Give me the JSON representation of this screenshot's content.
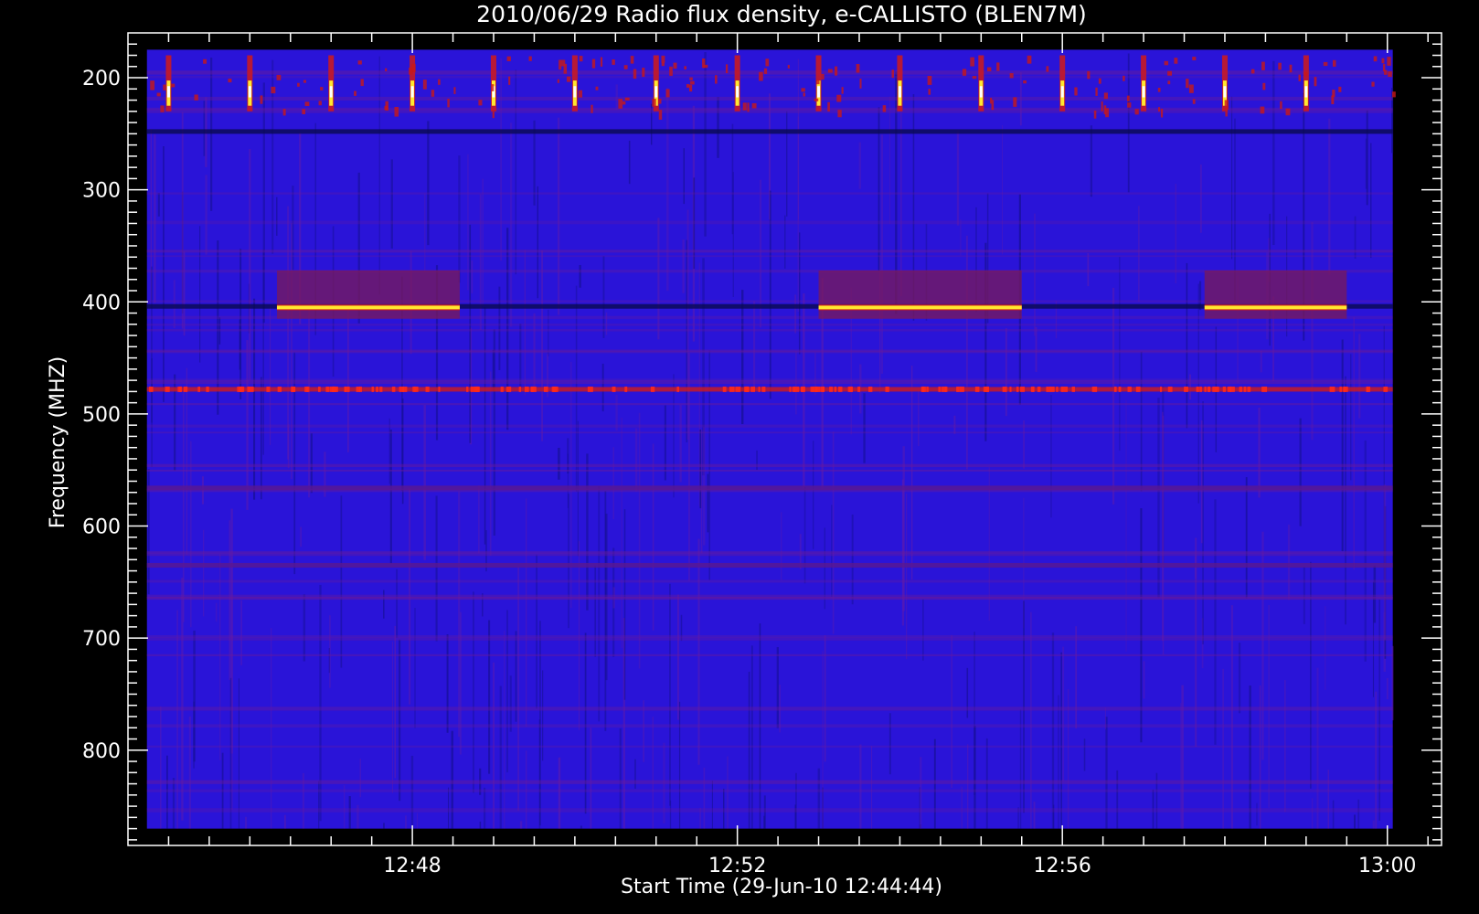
{
  "chart_data": {
    "type": "heatmap",
    "title": "2010/06/29  Radio flux density, e-CALLISTO (BLEN7M)",
    "xlabel": "Start Time (29-Jun-10 12:44:44)",
    "ylabel": "Frequency (MHZ)",
    "x_unit": "time (HH:MM UT)",
    "x_range": [
      "12:44:44",
      "13:00:04"
    ],
    "xlim": [
      "12:44:30",
      "13:00:40"
    ],
    "x_ticks": [
      "12:48",
      "12:52",
      "12:56",
      "13:00"
    ],
    "y_range_mhz": [
      175,
      870
    ],
    "ylim": [
      160,
      885
    ],
    "y_inverted": true,
    "y_ticks": [
      200,
      300,
      400,
      500,
      600,
      700,
      800
    ],
    "colormap": "blue-red-yellow-white",
    "colors": {
      "background": "#000000",
      "low": "#2a14d8",
      "mid": "#d01a1a",
      "high": "#ffe830",
      "peak": "#ffffff",
      "axes": "#ffffff"
    },
    "features": [
      {
        "kind": "continuous-band",
        "freq_mhz": 248,
        "level": "low"
      },
      {
        "kind": "continuous-band",
        "freq_mhz": 404,
        "level": "low"
      },
      {
        "kind": "continuous-band",
        "freq_mhz": 478,
        "level": "medium"
      },
      {
        "kind": "continuous-band",
        "freq_mhz": 566,
        "level": "low-medium"
      },
      {
        "kind": "continuous-band",
        "freq_mhz": 635,
        "level": "low-medium"
      },
      {
        "kind": "periodic-bursts",
        "freq_range_mhz": [
          180,
          230
        ],
        "period_min": 1.0,
        "first": "12:45:00",
        "last": "12:59:40"
      },
      {
        "kind": "strong-emission",
        "freq_mhz": 405,
        "time_range": [
          "12:46:20",
          "12:48:35"
        ]
      },
      {
        "kind": "strong-emission",
        "freq_mhz": 405,
        "time_range": [
          "12:53:00",
          "12:55:30"
        ]
      },
      {
        "kind": "strong-emission",
        "freq_mhz": 405,
        "time_range": [
          "12:57:45",
          "12:59:30"
        ]
      }
    ]
  }
}
